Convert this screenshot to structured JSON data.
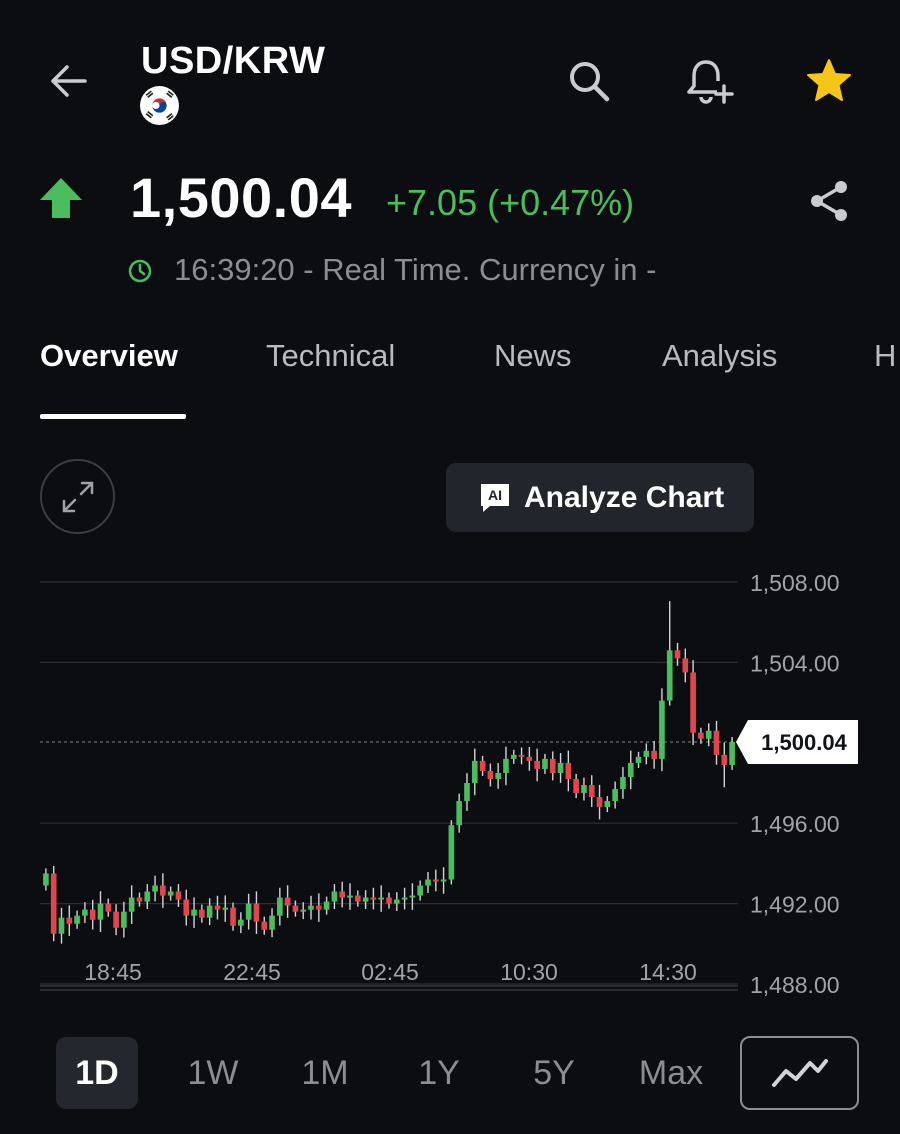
{
  "header": {
    "title": "USD/KRW",
    "icons": {
      "back": "back-arrow-icon",
      "flag": "south-korea-flag-icon",
      "search": "search-icon",
      "alert": "bell-plus-icon",
      "favorite": "star-icon"
    }
  },
  "quote": {
    "price": "1,500.04",
    "change": "+7.05 (+0.47%)",
    "time_status": "16:39:20 - Real Time. Currency in -",
    "direction": "up",
    "color_up": "#4bbd5e",
    "color_down": "#e2464d",
    "accent_star": "#f5c518"
  },
  "tabs": [
    {
      "label": "Overview",
      "active": true
    },
    {
      "label": "Technical",
      "active": false
    },
    {
      "label": "News",
      "active": false
    },
    {
      "label": "Analysis",
      "active": false
    },
    {
      "label": "H",
      "active": false
    }
  ],
  "chart_controls": {
    "analyze_label": "Analyze Chart",
    "ai_badge": "AI"
  },
  "ranges": [
    {
      "label": "1D",
      "active": true
    },
    {
      "label": "1W",
      "active": false
    },
    {
      "label": "1M",
      "active": false
    },
    {
      "label": "1Y",
      "active": false
    },
    {
      "label": "5Y",
      "active": false
    },
    {
      "label": "Max",
      "active": false
    }
  ],
  "chart_data": {
    "type": "candlestick",
    "y_ticks": [
      "1,508.00",
      "1,504.00",
      "1,496.00",
      "1,492.00",
      "1,488.00"
    ],
    "y_tick_values": [
      1508,
      1504,
      1496,
      1492,
      1488
    ],
    "ylim": [
      1488,
      1508
    ],
    "current_price_label": "1,500.04",
    "current_price": 1500.04,
    "x_labels": [
      "18:45",
      "22:45",
      "02:45",
      "10:30",
      "14:30"
    ],
    "grid": true,
    "closes": [
      1493.5,
      1490.5,
      1491.3,
      1491.0,
      1491.4,
      1491.7,
      1491.2,
      1492.0,
      1491.6,
      1490.8,
      1491.6,
      1492.3,
      1492.1,
      1492.6,
      1492.9,
      1492.4,
      1492.6,
      1492.2,
      1491.4,
      1491.7,
      1491.3,
      1491.9,
      1491.7,
      1491.8,
      1490.9,
      1491.2,
      1492.0,
      1491.1,
      1490.7,
      1491.4,
      1492.3,
      1491.9,
      1491.6,
      1491.7,
      1491.9,
      1491.7,
      1492.1,
      1492.6,
      1492.3,
      1492.4,
      1492.1,
      1492.3,
      1492.2,
      1492.3,
      1492.0,
      1492.2,
      1492.3,
      1492.4,
      1492.9,
      1493.2,
      1493.1,
      1493.2,
      1495.9,
      1497.1,
      1498.0,
      1499.1,
      1498.6,
      1498.2,
      1498.5,
      1499.2,
      1499.4,
      1499.3,
      1499.1,
      1498.7,
      1499.2,
      1498.5,
      1499.0,
      1498.2,
      1497.5,
      1497.9,
      1497.3,
      1496.8,
      1497.1,
      1497.7,
      1498.3,
      1499.0,
      1499.3,
      1499.6,
      1499.2,
      1502.1,
      1504.6,
      1504.2,
      1503.5,
      1500.5,
      1500.2,
      1500.6,
      1499.4,
      1498.9,
      1500.04
    ]
  }
}
